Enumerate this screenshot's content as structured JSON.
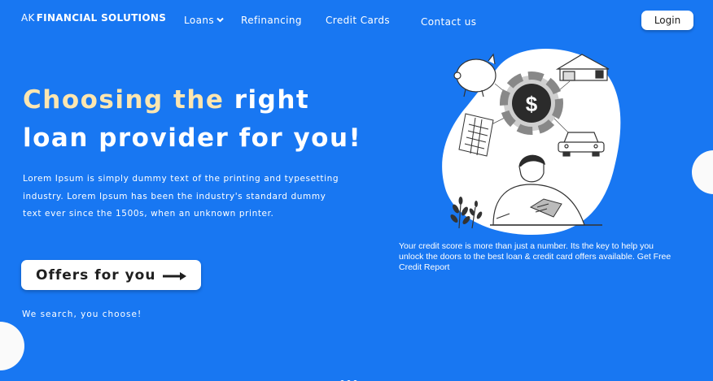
{
  "nav": {
    "logo_prefix": "AK",
    "logo_text": "FINANCIAL SOLUTIONS",
    "loans": "Loans",
    "refinancing": "Refinancing",
    "credit_cards": "Credit Cards",
    "contact": "Contact us",
    "login": "Login"
  },
  "hero": {
    "headline_highlight": "Choosing the",
    "headline_rest_1": " right",
    "headline_line2": "loan provider for you!",
    "paragraph": "Lorem Ipsum is simply dummy text of the printing and typesetting industry. Lorem Ipsum has been the industry's standard dummy text ever since the 1500s, when an unknown printer.",
    "cta_label": "Offers for you",
    "tagline": "We search, you choose!"
  },
  "illustration": {
    "caption": "Your credit score is more than just a number. Its the key to help you unlock the doors to the best loan & credit  card offers available. Get Free Credit Report",
    "dollar_symbol": "$"
  },
  "icons": {
    "nav_loans": "chevron-down-icon",
    "cta": "arrow-right-icon",
    "illustration": [
      "piggy-bank-icon",
      "house-icon",
      "dollar-coin-icon",
      "document-icon",
      "car-icon",
      "person-icon",
      "plant-icon"
    ]
  },
  "colors": {
    "background": "#1877f2",
    "headline_highlight": "#fde6b0",
    "button_bg": "#ffffff",
    "blob": "#ffffff"
  }
}
